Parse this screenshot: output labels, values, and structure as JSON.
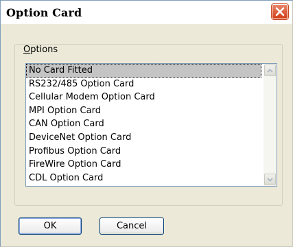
{
  "window": {
    "title": "Option Card",
    "close_icon": "close-x-icon"
  },
  "group": {
    "label_mnemonic": "O",
    "label_rest": "ptions"
  },
  "list": {
    "selected_index": 0,
    "items": [
      "No Card Fitted",
      "RS232/485 Option Card",
      "Cellular Modem Option Card",
      "MPI Option Card",
      "CAN Option Card",
      "DeviceNet Option Card",
      "Profibus Option Card",
      "FireWire Option Card",
      "CDL Option Card"
    ]
  },
  "buttons": {
    "ok": "OK",
    "cancel": "Cancel"
  },
  "colors": {
    "dialog_bg": "#ece9d8",
    "close_button": "#d23c14",
    "selection_bg": "#c4c4c4",
    "focus_border": "#003c74"
  }
}
